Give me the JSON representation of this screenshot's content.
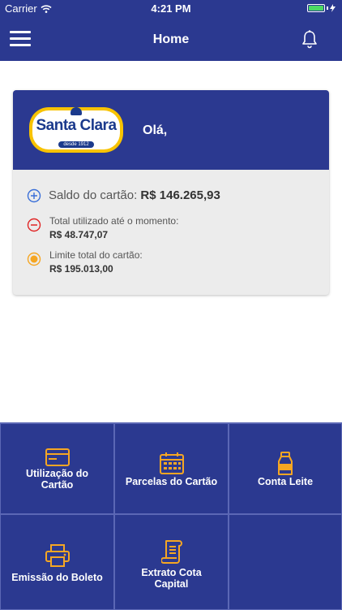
{
  "status_bar": {
    "carrier": "Carrier",
    "time": "4:21 PM"
  },
  "nav": {
    "title": "Home",
    "menu_icon": "hamburger-menu-icon",
    "bell_icon": "bell-icon"
  },
  "card": {
    "logo": {
      "text": "Santa Clara",
      "subtitle": "desde 1912"
    },
    "greeting": "Olá,",
    "saldo": {
      "label": "Saldo do cartão:",
      "value": "R$ 146.265,93",
      "icon": "plus-circle-icon"
    },
    "utilizado": {
      "label": "Total utilizado até o momento:",
      "value": "R$ 48.747,07",
      "icon": "minus-circle-icon"
    },
    "limite": {
      "label": "Limite total do cartão:",
      "value": "R$ 195.013,00",
      "icon": "radio-dot-icon"
    }
  },
  "menu": [
    {
      "line1": "Utilização do",
      "line2": "Cartão",
      "icon": "credit-card-icon"
    },
    {
      "line1": "Parcelas do Cartão",
      "line2": "",
      "icon": "calendar-icon"
    },
    {
      "line1": "Conta Leite",
      "line2": "",
      "icon": "milk-bottle-icon"
    },
    {
      "line1": "Emissão do Boleto",
      "line2": "",
      "icon": "printer-icon"
    },
    {
      "line1": "Extrato Cota",
      "line2": "Capital",
      "icon": "receipt-icon"
    }
  ],
  "colors": {
    "primary": "#2b3990",
    "accent": "#f5a623",
    "negative": "#e02424",
    "positive": "#3a6fd8",
    "card_bg": "#ececec"
  }
}
